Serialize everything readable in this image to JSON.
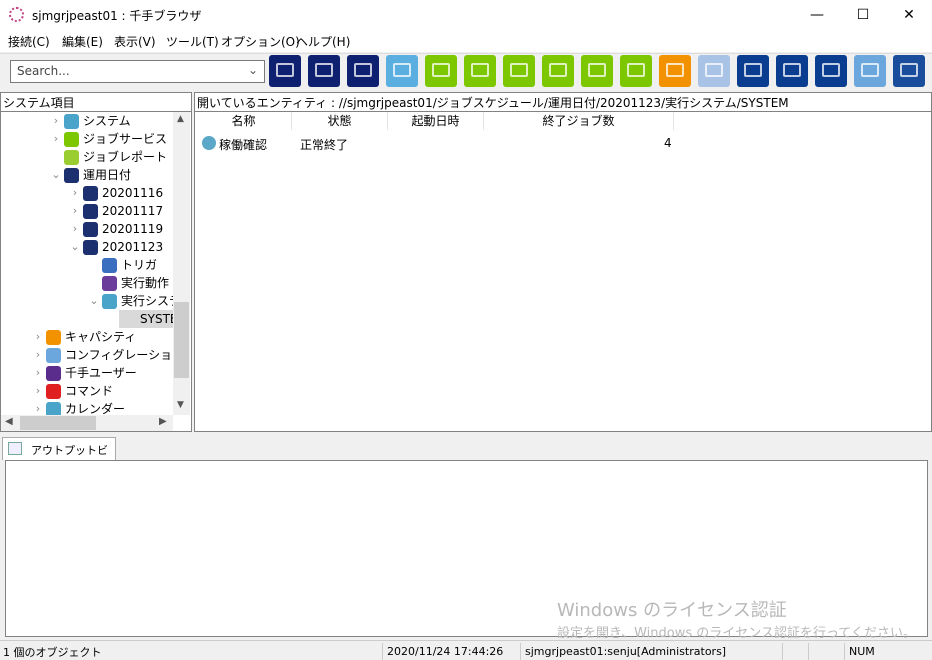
{
  "window": {
    "title": "sjmgrjpeast01 : 千手ブラウザ",
    "minimize": "—",
    "maximize": "☐",
    "close": "✕"
  },
  "menu": [
    "接続(C)",
    "編集(E)",
    "表示(V)",
    "ツール(T)",
    "オプション(O)",
    "ヘルプ(H)"
  ],
  "toolbar": {
    "search_placeholder": "Search...",
    "icons": [
      {
        "name": "monitor-grid-icon",
        "color": "#0d2170"
      },
      {
        "name": "monitor-icon",
        "color": "#0d2170"
      },
      {
        "name": "monitor-stack-icon",
        "color": "#0d2170"
      },
      {
        "name": "message-icon",
        "color": "#5aaee0"
      },
      {
        "name": "gear-job-icon",
        "color": "#7dc700"
      },
      {
        "name": "job-check-icon",
        "color": "#7dc700"
      },
      {
        "name": "job-camera-icon",
        "color": "#7dc700"
      },
      {
        "name": "monitor-check-icon",
        "color": "#7dc700"
      },
      {
        "name": "chart-report-icon",
        "color": "#7dc700"
      },
      {
        "name": "gantt-icon",
        "color": "#7dc700"
      },
      {
        "name": "bar-chart-icon",
        "color": "#f39200"
      },
      {
        "name": "config-icon",
        "color": "#a9c3e6"
      },
      {
        "name": "gear-export-icon",
        "color": "#0a3d8f"
      },
      {
        "name": "check-export-icon",
        "color": "#0a3d8f"
      },
      {
        "name": "camera-export-icon",
        "color": "#0a3d8f"
      },
      {
        "name": "log-icon",
        "color": "#6ba7dc"
      },
      {
        "name": "radar-icon",
        "color": "#1a4e9c"
      }
    ]
  },
  "tree": {
    "header": "システム項目",
    "items": [
      {
        "label": "システム",
        "level": 2,
        "arrow": "›",
        "icon": "system-icon",
        "color": "#4aa3c8"
      },
      {
        "label": "ジョブサービス",
        "level": 2,
        "arrow": "›",
        "icon": "job-service-icon",
        "color": "#7dc700"
      },
      {
        "label": "ジョブレポート",
        "level": 2,
        "arrow": "",
        "icon": "job-report-icon",
        "color": "#9acd32"
      },
      {
        "label": "運用日付",
        "level": 2,
        "arrow": "⌄",
        "icon": "calendar-icon",
        "color": "#1c2f6e"
      },
      {
        "label": "20201116",
        "level": 3,
        "arrow": "›",
        "icon": "calendar-icon",
        "color": "#1c2f6e"
      },
      {
        "label": "20201117",
        "level": 3,
        "arrow": "›",
        "icon": "calendar-icon",
        "color": "#1c2f6e"
      },
      {
        "label": "20201119",
        "level": 3,
        "arrow": "›",
        "icon": "calendar-icon",
        "color": "#1c2f6e"
      },
      {
        "label": "20201123",
        "level": 3,
        "arrow": "⌄",
        "icon": "calendar-icon",
        "color": "#1c2f6e"
      },
      {
        "label": "トリガ",
        "level": 4,
        "arrow": "",
        "icon": "trigger-icon",
        "color": "#3a6fbf"
      },
      {
        "label": "実行動作",
        "level": 4,
        "arrow": "",
        "icon": "action-icon",
        "color": "#6a3d9a"
      },
      {
        "label": "実行システ",
        "level": 4,
        "arrow": "⌄",
        "icon": "system-icon",
        "color": "#4aa3c8"
      },
      {
        "label": "SYSTEM",
        "level": 5,
        "arrow": "",
        "icon": "system-icon",
        "color": "#4aa3c8",
        "selected": true
      },
      {
        "label": "キャパシティ",
        "level": 1,
        "arrow": "›",
        "icon": "capacity-icon",
        "color": "#f39200"
      },
      {
        "label": "コンフィグレーション",
        "level": 1,
        "arrow": "›",
        "icon": "config-icon",
        "color": "#6ba7dc"
      },
      {
        "label": "千手ユーザー",
        "level": 1,
        "arrow": "›",
        "icon": "user-icon",
        "color": "#5a2d8c"
      },
      {
        "label": "コマンド",
        "level": 1,
        "arrow": "›",
        "icon": "command-icon",
        "color": "#e02020"
      },
      {
        "label": "カレンダー",
        "level": 1,
        "arrow": "›",
        "icon": "calendar-grid-icon",
        "color": "#4aa3c8"
      }
    ]
  },
  "entity": {
    "path": "開いているエンティティ : //sjmgrjpeast01/ジョブスケジュール/運用日付/20201123/実行システム/SYSTEM"
  },
  "list": {
    "columns": [
      "名称",
      "状態",
      "起動日時",
      "終了ジョブ数"
    ],
    "rows": [
      {
        "name": "稼働確認",
        "status": "正常終了",
        "start": "",
        "count": "4"
      }
    ]
  },
  "output": {
    "tab": "アウトプットビュー"
  },
  "watermark": {
    "line1": "Windows のライセンス認証",
    "line2": "設定を開き、Windows のライセンス認証を行ってください。"
  },
  "status": {
    "objects": "1 個のオブジェクト",
    "datetime": "2020/11/24 17:44:26",
    "user": "sjmgrjpeast01:senju[Administrators]",
    "num": "NUM"
  }
}
